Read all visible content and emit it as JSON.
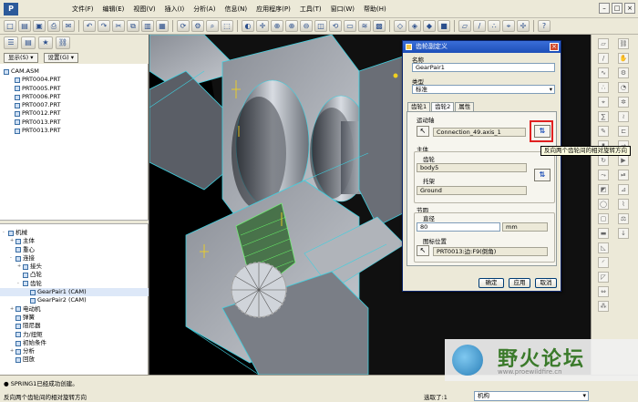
{
  "menubar": {
    "items": [
      "文件(F)",
      "编辑(E)",
      "视图(V)",
      "插入(I)",
      "分析(A)",
      "信息(N)",
      "应用程序(P)",
      "工具(T)",
      "窗口(W)",
      "帮助(H)"
    ]
  },
  "left_panel": {
    "show_button": "显示(S) ▾",
    "settings_button": "设置(G) ▾",
    "model_tree": {
      "root": "CAM.ASM",
      "parts": [
        "PRT0004.PRT",
        "PRT0005.PRT",
        "PRT0006.PRT",
        "PRT0007.PRT",
        "PRT0012.PRT",
        "PRT0013.PRT",
        "PRT0013.PRT"
      ]
    },
    "mechanism_tree": {
      "root": "机械",
      "items": [
        {
          "label": "主体",
          "level": 1,
          "expander": "+"
        },
        {
          "label": "重心",
          "level": 1,
          "expander": ""
        },
        {
          "label": "连接",
          "level": 1,
          "expander": "-"
        },
        {
          "label": "接头",
          "level": 2,
          "expander": "+"
        },
        {
          "label": "凸轮",
          "level": 2,
          "expander": ""
        },
        {
          "label": "齿轮",
          "level": 2,
          "expander": "-"
        },
        {
          "label": "GearPair1 (CAM)",
          "level": 3,
          "expander": ""
        },
        {
          "label": "GearPair2 (CAM)",
          "level": 3,
          "expander": ""
        },
        {
          "label": "电动机",
          "level": 1,
          "expander": "+"
        },
        {
          "label": "弹簧",
          "level": 1,
          "expander": ""
        },
        {
          "label": "阻尼器",
          "level": 1,
          "expander": ""
        },
        {
          "label": "力/扭矩",
          "level": 1,
          "expander": ""
        },
        {
          "label": "初始条件",
          "level": 1,
          "expander": ""
        },
        {
          "label": "分析",
          "level": 1,
          "expander": "+"
        },
        {
          "label": "回放",
          "level": 1,
          "expander": ""
        }
      ]
    }
  },
  "dialog": {
    "title": "齿轮副定义",
    "name_label": "名称",
    "name_value": "GearPair1",
    "type_label": "类型",
    "type_value": "标准",
    "tabs": [
      "齿轮1",
      "齿轮2",
      "属性"
    ],
    "active_tab": "齿轮2",
    "motion_axis_label": "运动轴",
    "motion_axis_value": "Connection_49.axis_1",
    "body_label": "主体",
    "gear_label": "齿轮",
    "gear_value": "body5",
    "carrier_label": "托架",
    "carrier_value": "Ground",
    "pitch_circle_label": "节圆",
    "diameter_label": "直径",
    "diameter_value": "80",
    "diameter_unit": "mm",
    "icon_position_label": "图标位置",
    "icon_position_value": "PRT0013:边:F9(倒角)",
    "ok_button": "确定",
    "apply_button": "应用",
    "cancel_button": "取消",
    "flip_icon": "⇅"
  },
  "tooltip": "反向两个齿轮间的相对旋转方向",
  "status": {
    "message1": "● SPRING1已经成功创建。",
    "message2": "反向两个齿轮间的相对旋转方向",
    "selected": "选取了:1",
    "filter": "机构"
  },
  "watermark": {
    "text": "野火论坛",
    "url": "www.proewildfire.cn"
  },
  "colors": {
    "titlebar": "#1d4fb8",
    "highlight_box": "#e02020",
    "viewport_bg": "#000000",
    "cyan_edges": "#3fd0e0"
  }
}
